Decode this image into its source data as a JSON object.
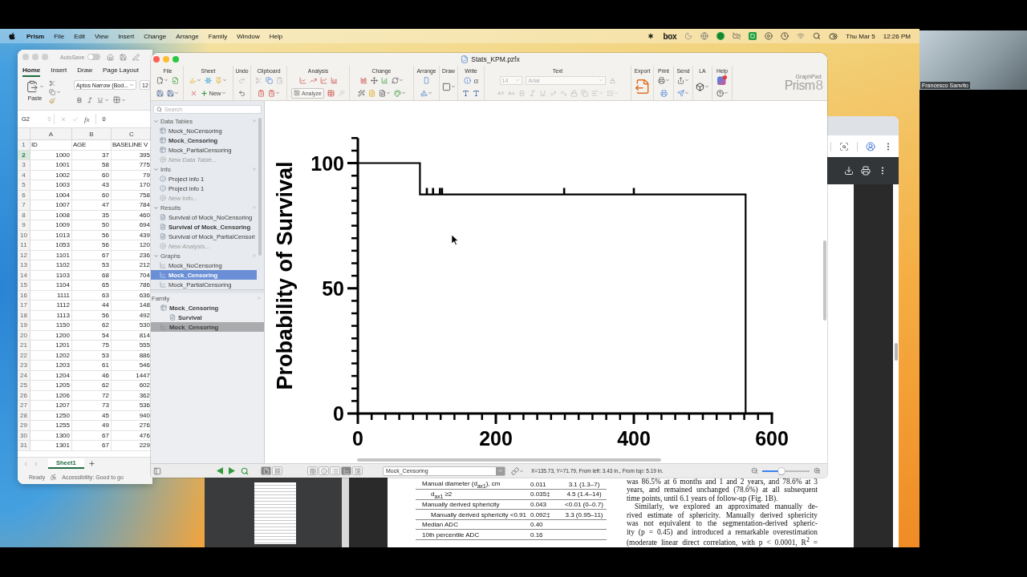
{
  "menu_bar": {
    "app_name": "Prism",
    "menus": [
      "File",
      "Edit",
      "View",
      "Insert",
      "Change",
      "Arrange",
      "Family",
      "Window",
      "Help"
    ],
    "status_label": "box",
    "date": "Thu Mar 5",
    "time": "12:26 PM"
  },
  "spreadsheet": {
    "autosave": {
      "label": "AutoSave",
      "on": false
    },
    "tabs": [
      {
        "label": "Home",
        "selected": true
      },
      {
        "label": "Insert",
        "selected": false
      },
      {
        "label": "Draw",
        "selected": false
      },
      {
        "label": "Page Layout",
        "selected": false
      }
    ],
    "paste_label": "Paste",
    "font_name": "Aptos Narrow (Bod...",
    "font_size": "12",
    "name_box": "G2",
    "function_label": "fx",
    "formula_value": "0",
    "columns": [
      "A",
      "B",
      "C"
    ],
    "rows": [
      {
        "number": "1",
        "kind": "text",
        "selected": false,
        "cells": [
          "ID",
          "AGE",
          "BASELINE V"
        ]
      },
      {
        "number": "2",
        "kind": "number",
        "selected": true,
        "cells": [
          "1000",
          "37",
          "395"
        ]
      },
      {
        "number": "3",
        "kind": "number",
        "selected": false,
        "cells": [
          "1001",
          "58",
          "775"
        ]
      },
      {
        "number": "4",
        "kind": "number",
        "selected": false,
        "cells": [
          "1002",
          "60",
          "79"
        ]
      },
      {
        "number": "5",
        "kind": "number",
        "selected": false,
        "cells": [
          "1003",
          "43",
          "170"
        ]
      },
      {
        "number": "6",
        "kind": "number",
        "selected": false,
        "cells": [
          "1004",
          "60",
          "758"
        ]
      },
      {
        "number": "7",
        "kind": "number",
        "selected": false,
        "cells": [
          "1007",
          "47",
          "784"
        ]
      },
      {
        "number": "8",
        "kind": "number",
        "selected": false,
        "cells": [
          "1008",
          "35",
          "460"
        ]
      },
      {
        "number": "9",
        "kind": "number",
        "selected": false,
        "cells": [
          "1009",
          "50",
          "694"
        ]
      },
      {
        "number": "10",
        "kind": "number",
        "selected": false,
        "cells": [
          "1013",
          "56",
          "439"
        ]
      },
      {
        "number": "11",
        "kind": "number",
        "selected": false,
        "cells": [
          "1053",
          "56",
          "120"
        ]
      },
      {
        "number": "12",
        "kind": "number",
        "selected": false,
        "cells": [
          "1101",
          "67",
          "236"
        ]
      },
      {
        "number": "13",
        "kind": "number",
        "selected": false,
        "cells": [
          "1102",
          "53",
          "212"
        ]
      },
      {
        "number": "14",
        "kind": "number",
        "selected": false,
        "cells": [
          "1103",
          "68",
          "704"
        ]
      },
      {
        "number": "15",
        "kind": "number",
        "selected": false,
        "cells": [
          "1104",
          "65",
          "786"
        ]
      },
      {
        "number": "16",
        "kind": "number",
        "selected": false,
        "cells": [
          "1111",
          "63",
          "636"
        ]
      },
      {
        "number": "17",
        "kind": "number",
        "selected": false,
        "cells": [
          "1112",
          "44",
          "148"
        ]
      },
      {
        "number": "18",
        "kind": "number",
        "selected": false,
        "cells": [
          "1113",
          "56",
          "492"
        ]
      },
      {
        "number": "19",
        "kind": "number",
        "selected": false,
        "cells": [
          "1150",
          "62",
          "530"
        ]
      },
      {
        "number": "20",
        "kind": "number",
        "selected": false,
        "cells": [
          "1200",
          "54",
          "814"
        ]
      },
      {
        "number": "21",
        "kind": "number",
        "selected": false,
        "cells": [
          "1201",
          "75",
          "555"
        ]
      },
      {
        "number": "22",
        "kind": "number",
        "selected": false,
        "cells": [
          "1202",
          "53",
          "886"
        ]
      },
      {
        "number": "23",
        "kind": "number",
        "selected": false,
        "cells": [
          "1203",
          "61",
          "546"
        ]
      },
      {
        "number": "24",
        "kind": "number",
        "selected": false,
        "cells": [
          "1204",
          "46",
          "1447"
        ]
      },
      {
        "number": "25",
        "kind": "number",
        "selected": false,
        "cells": [
          "1205",
          "62",
          "602"
        ]
      },
      {
        "number": "26",
        "kind": "number",
        "selected": false,
        "cells": [
          "1206",
          "72",
          "362"
        ]
      },
      {
        "number": "27",
        "kind": "number",
        "selected": false,
        "cells": [
          "1207",
          "73",
          "536"
        ]
      },
      {
        "number": "28",
        "kind": "number",
        "selected": false,
        "cells": [
          "1250",
          "45",
          "940"
        ]
      },
      {
        "number": "29",
        "kind": "number",
        "selected": false,
        "cells": [
          "1255",
          "49",
          "276"
        ]
      },
      {
        "number": "30",
        "kind": "number",
        "selected": false,
        "cells": [
          "1300",
          "67",
          "476"
        ]
      },
      {
        "number": "31",
        "kind": "number",
        "selected": false,
        "cells": [
          "1301",
          "67",
          "229"
        ]
      }
    ],
    "sheets": [
      {
        "label": "Sheet1",
        "selected": true
      }
    ],
    "status": "Ready",
    "accessibility": "Accessibility: Good to go"
  },
  "prism": {
    "title": "Stats_KPM.pzfx",
    "toolbar_groups": [
      {
        "label": "File"
      },
      {
        "label": "Sheet",
        "button": "New"
      },
      {
        "label": "Undo"
      },
      {
        "label": "Clipboard"
      },
      {
        "label": "Analysis",
        "button": "Analyze"
      },
      {
        "label": "Change"
      },
      {
        "label": "Arrange"
      },
      {
        "label": "Draw"
      },
      {
        "label": "Write",
        "symbol": "α"
      },
      {
        "label": "Text",
        "font_size": "14",
        "font": "Arial",
        "disabled": true
      },
      {
        "label": "Export"
      },
      {
        "label": "Print"
      },
      {
        "label": "Send"
      },
      {
        "label": "LA"
      },
      {
        "label": "Help"
      }
    ],
    "logo": {
      "maker": "GraphPad",
      "name": "Prism",
      "version": "8"
    },
    "navigator": {
      "search_placeholder": "Search",
      "sections": [
        {
          "title": "Data Tables",
          "expanded": true,
          "items": [
            {
              "label": "Mock_NoCensoring",
              "kind": "table",
              "current": false,
              "selected": false
            },
            {
              "label": "Mock_Censoring",
              "kind": "table",
              "current": true,
              "selected": false
            },
            {
              "label": "Mock_PartialCensoring",
              "kind": "table",
              "current": false,
              "selected": false
            },
            {
              "label": "New Data Table...",
              "kind": "new",
              "current": false,
              "selected": false
            }
          ]
        },
        {
          "title": "Info",
          "expanded": true,
          "items": [
            {
              "label": "Project info 1",
              "kind": "info",
              "current": false,
              "selected": false
            },
            {
              "label": "Project info 1",
              "kind": "info",
              "current": false,
              "selected": false
            },
            {
              "label": "New Info...",
              "kind": "new",
              "current": false,
              "selected": false
            }
          ]
        },
        {
          "title": "Results",
          "expanded": true,
          "items": [
            {
              "label": "Survival of Mock_NoCensoring",
              "kind": "result",
              "current": false,
              "selected": false
            },
            {
              "label": "Survival of Mock_Censoring",
              "kind": "result",
              "current": true,
              "selected": false
            },
            {
              "label": "Survival of Mock_PartialCensori",
              "kind": "result",
              "current": false,
              "selected": false
            },
            {
              "label": "New Analysis...",
              "kind": "new",
              "current": false,
              "selected": false
            }
          ]
        },
        {
          "title": "Graphs",
          "expanded": true,
          "items": [
            {
              "label": "Mock_NoCensoring",
              "kind": "graph",
              "current": false,
              "selected": false
            },
            {
              "label": "Mock_Censoring",
              "kind": "graph",
              "current": true,
              "selected": true
            },
            {
              "label": "Mock_PartialCensoring",
              "kind": "graph",
              "current": false,
              "selected": false
            }
          ]
        }
      ]
    },
    "family": {
      "title": "Family",
      "items": [
        {
          "label": "Mock_Censoring",
          "kind": "table",
          "selected": false,
          "children": [
            {
              "label": "Survival",
              "kind": "result",
              "selected": false
            }
          ]
        },
        {
          "label": "Mock_Censoring",
          "kind": "graph",
          "selected": true
        }
      ]
    },
    "graph": {
      "chart_data": {
        "type": "line",
        "ylabel": "Probability of Survival",
        "x": [
          0,
          90,
          90,
          100,
          109,
          119,
          122,
          299,
          400,
          562,
          562
        ],
        "series": [
          {
            "color": "#000000",
            "values": [
              100,
              100,
              87.5,
              87.5,
              87.5,
              87.5,
              87.5,
              87.5,
              87.5,
              87.5,
              0
            ]
          }
        ],
        "xlim": [
          0,
          600
        ],
        "ylim": [
          0,
          110
        ],
        "xticks": [
          0,
          200,
          400,
          600
        ],
        "yticks": [
          0,
          50,
          100
        ]
      }
    },
    "status_bar": {
      "page_views": [
        {
          "kind": "page",
          "selected": true
        },
        {
          "kind": "grid",
          "selected": false
        }
      ],
      "sheet_types": [
        {
          "kind": "table",
          "selected": false
        },
        {
          "kind": "info",
          "selected": false
        },
        {
          "kind": "results",
          "selected": false
        },
        {
          "kind": "graph",
          "selected": true
        },
        {
          "kind": "layout",
          "selected": false
        }
      ],
      "sheet_name": "Mock_Censoring",
      "cursor_position": "X=135.73, Y=71.79, From left: 3.43 in., From top: 5.19 in.",
      "zoom": {
        "level": 0.4
      }
    }
  },
  "pdf_viewer": {
    "table_rows": [
      {
        "cells": [
          "Manual diameter (d$_{ax1}$), cm",
          "0.011",
          "3.1 (1.3–7)"
        ],
        "children": [
          {
            "cells": [
              "d$_{ax1}$ ≥2",
              "0.035‡",
              "4.5 (1.4–14)"
            ]
          }
        ]
      },
      {
        "cells": [
          "Manually derived sphericity",
          "0.043",
          "<0.01 (0–0.7)"
        ],
        "children": [
          {
            "cells": [
              "Manually derived sphericity <0.91",
              "0.092‡",
              "3.3 (0.95–11)"
            ]
          }
        ]
      },
      {
        "cells": [
          "Median ADC",
          "0.40"
        ]
      },
      {
        "cells": [
          "10th percentile ADC",
          "0.16"
        ]
      }
    ],
    "paragraphs": [
      {
        "indented": false,
        "complete": true,
        "lines": [
          "was 86.5% at 6 months and 1 and 2 years, and 78.6% at 3",
          "years, and remained unchanged (78.6%) at all subsequent",
          "time points, until 6.1 years of follow-up (Fig. 1B)."
        ]
      },
      {
        "indented": true,
        "complete": false,
        "lines": [
          "Similarly, we explored an approximated manually de-",
          "rived estimate of sphericity. Manually derived sphericity",
          "was not equivalent to the segmentation-derived spheric-",
          "ity (p = 0.45) and introduced a remarkable overestimation",
          "(moderate linear direct correlation, with p < 0.0001, R$^{2}$ ="
        ]
      }
    ]
  },
  "video_call": {
    "participant": "Francesco Sanvito"
  }
}
